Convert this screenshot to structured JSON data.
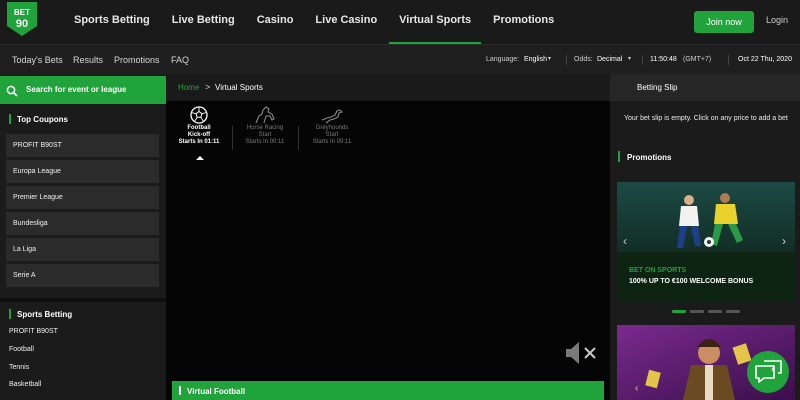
{
  "brand": {
    "logo_top": "BET",
    "logo_bottom": "90",
    "accent": "#1fa33a"
  },
  "nav": {
    "items": [
      {
        "label": "Sports Betting",
        "active": false
      },
      {
        "label": "Live Betting",
        "active": false
      },
      {
        "label": "Casino",
        "active": false
      },
      {
        "label": "Live Casino",
        "active": false
      },
      {
        "label": "Virtual Sports",
        "active": true
      },
      {
        "label": "Promotions",
        "active": false
      }
    ],
    "join_label": "Join now",
    "login_label": "Login"
  },
  "subnav": {
    "items": [
      "Today's Bets",
      "Results",
      "Promotions",
      "FAQ"
    ],
    "language_label": "Language:",
    "language_value": "English",
    "odds_label": "Odds:",
    "odds_value": "Decimal",
    "time": "11:50:48",
    "timezone": "(GMT+7)",
    "date": "Oct 22 Thu, 2020"
  },
  "sidebar": {
    "search_label": "Search for event or league",
    "top_coupons_title": "Top Coupons",
    "coupons": [
      "PROFIT B90ST",
      "Europa League",
      "Premier League",
      "Bundesliga",
      "La Liga",
      "Serie A"
    ],
    "sports_title": "Sports Betting",
    "sports": [
      "PROFIT B90ST",
      "Football",
      "Tennis",
      "Basketball"
    ]
  },
  "center": {
    "breadcrumb_home": "Home",
    "breadcrumb_sep": ">",
    "breadcrumb_current": "Virtual Sports",
    "tabs": [
      {
        "line1": "Football",
        "line2": "Kick-off",
        "line3": "Starts In 01:11",
        "icon": "football-icon",
        "active": true
      },
      {
        "line1": "Horse Racing",
        "line2": "Start",
        "line3": "Starts In 00:11",
        "icon": "horse-icon",
        "active": false
      },
      {
        "line1": "Greyhounds",
        "line2": "Start",
        "line3": "Starts In 09:11",
        "icon": "greyhound-icon",
        "active": false
      }
    ],
    "section_title": "Virtual Football"
  },
  "right": {
    "slip_title": "Betting Slip",
    "slip_message": "Your bet slip is empty. Click on any price to add a bet",
    "promotions_title": "Promotions",
    "banner_title": "BET ON SPORTS",
    "banner_subtitle": "100% UP TO €100 WELCOME BONUS",
    "banner_prev": "‹",
    "banner_next": "›",
    "slides_total": 4,
    "slide_active": 1
  }
}
